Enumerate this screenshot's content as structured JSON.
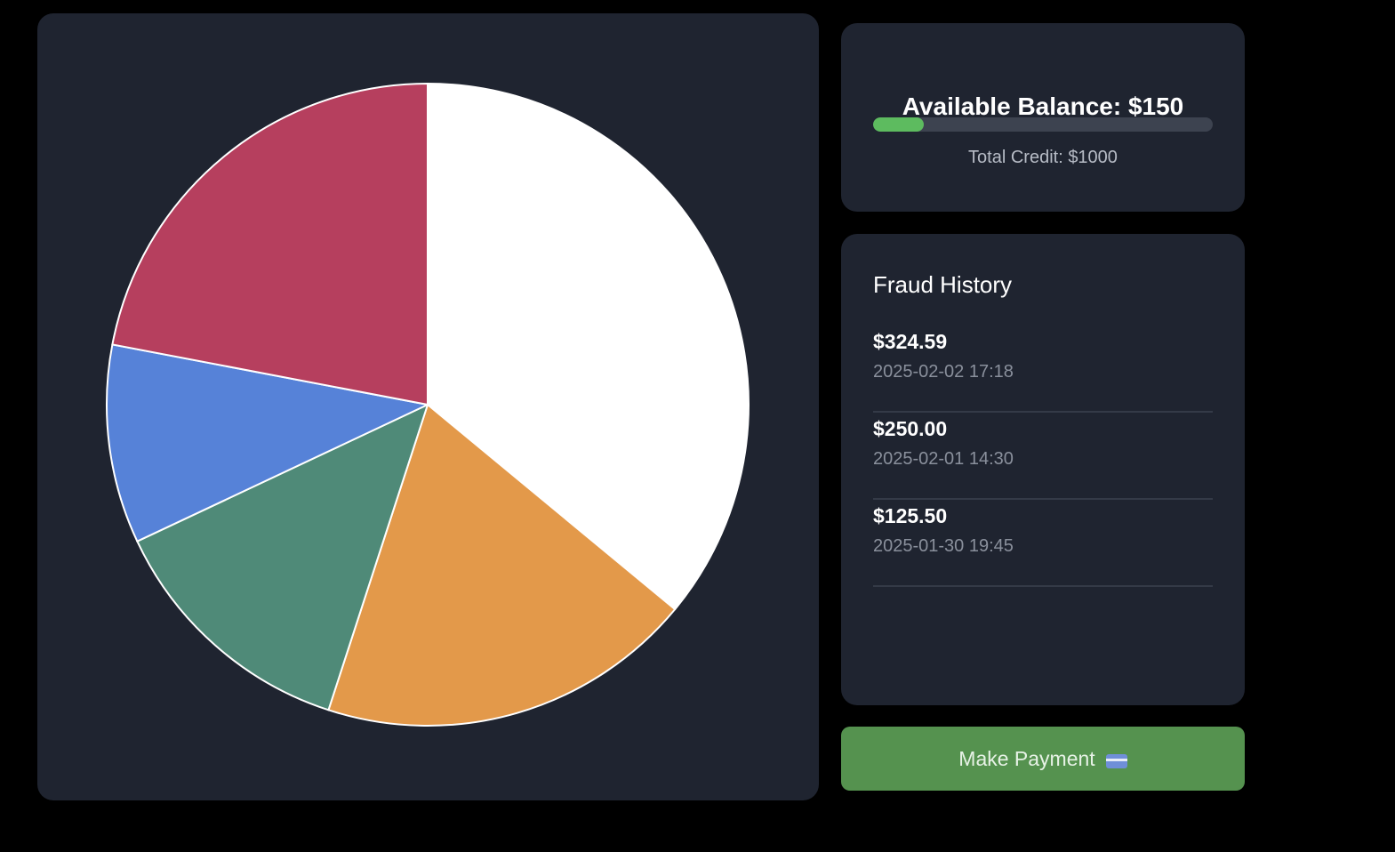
{
  "chart_data": {
    "type": "pie",
    "values": [
      36,
      19,
      13,
      10,
      22
    ],
    "colors": [
      "#ffffff",
      "#e3994a",
      "#4f8a78",
      "#5682d8",
      "#b63f5e"
    ],
    "border_color": "#ffffff"
  },
  "balance": {
    "title": "Available Balance: $150",
    "fraction": 0.15,
    "total_credit": "Total Credit: $1000",
    "progress_color": "#5dbb5f"
  },
  "fraud": {
    "title": "Fraud History",
    "items": [
      {
        "amount": "$324.59",
        "date": "2025-02-02 17:18"
      },
      {
        "amount": "$250.00",
        "date": "2025-02-01 14:30"
      },
      {
        "amount": "$125.50",
        "date": "2025-01-30 19:45"
      }
    ]
  },
  "payment": {
    "label": "Make Payment",
    "icon": "credit-card-icon",
    "color": "#55924f"
  }
}
